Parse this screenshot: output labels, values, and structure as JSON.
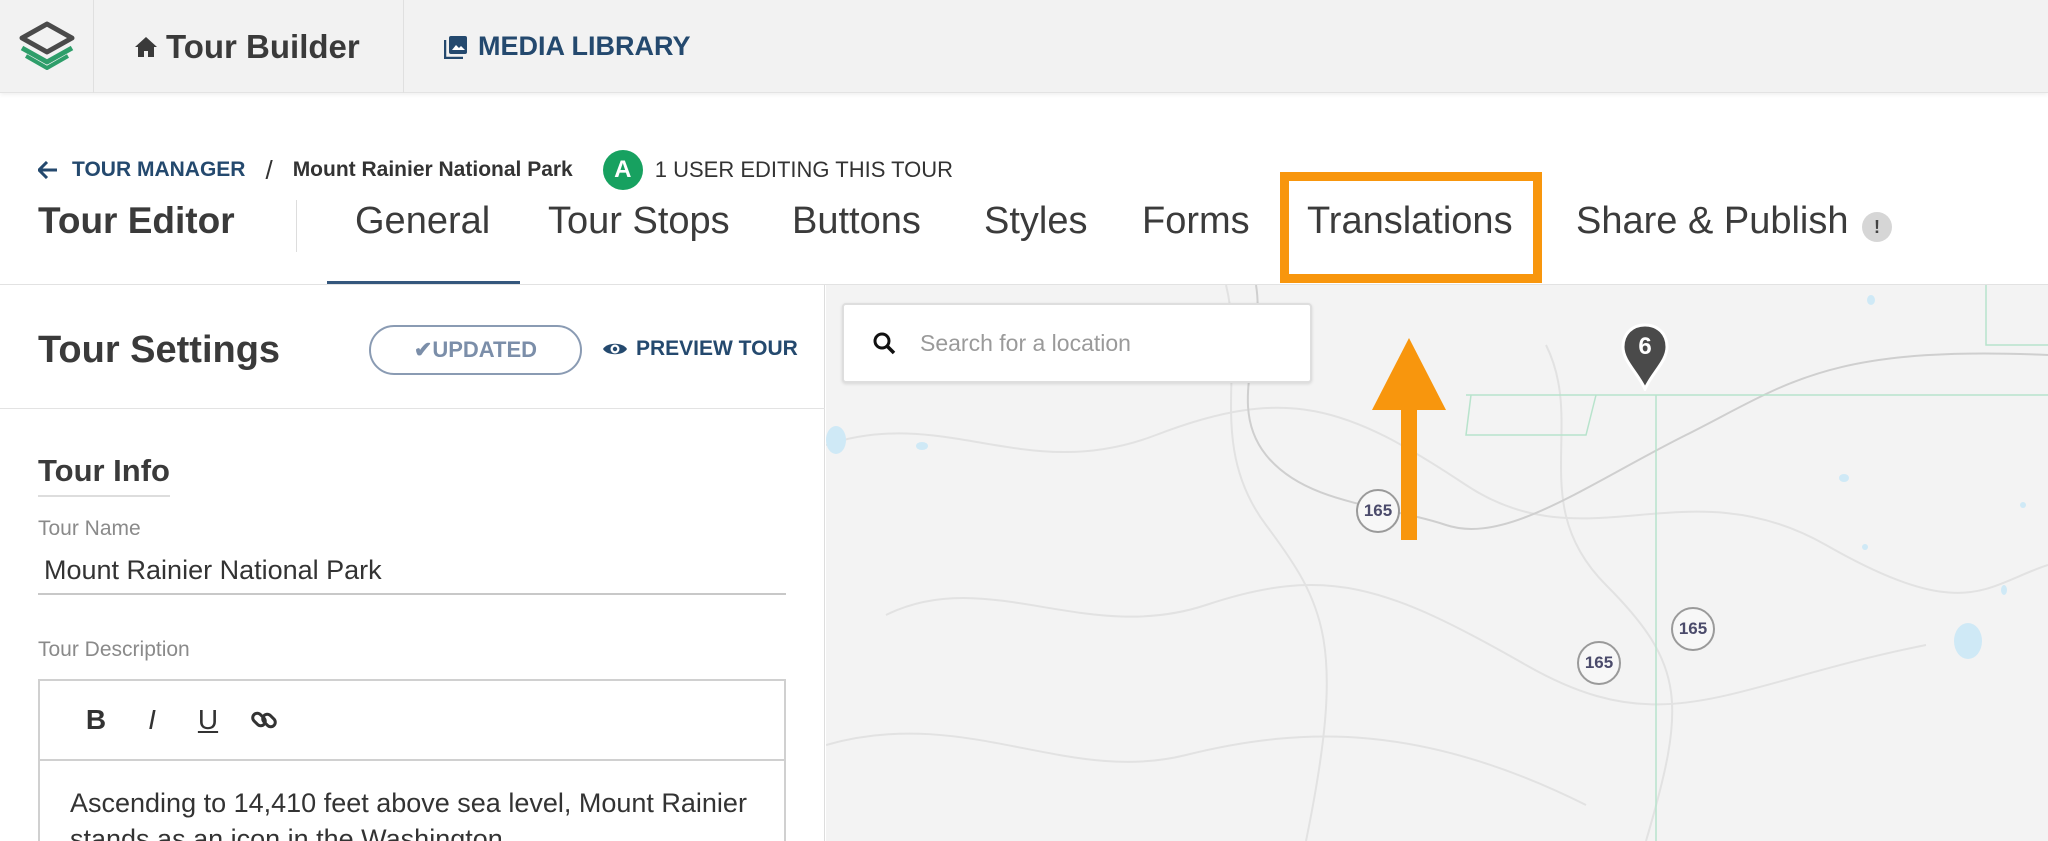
{
  "topbar": {
    "app_name": "Tour Builder",
    "media_library": "MEDIA LIBRARY"
  },
  "breadcrumb": {
    "back_label": "TOUR MANAGER",
    "separator": "/",
    "current": "Mount Rainier National Park",
    "avatar_initial": "A",
    "editing_status": "1 USER EDITING THIS TOUR"
  },
  "editor": {
    "title": "Tour Editor",
    "tabs": [
      {
        "label": "General",
        "active": true
      },
      {
        "label": "Tour Stops"
      },
      {
        "label": "Buttons"
      },
      {
        "label": "Styles"
      },
      {
        "label": "Forms"
      },
      {
        "label": "Translations",
        "highlighted": true
      },
      {
        "label": "Share & Publish"
      }
    ],
    "alert_badge": "!"
  },
  "settings": {
    "title": "Tour Settings",
    "updated_label": "✔UPDATED",
    "preview_label": "PREVIEW TOUR",
    "section_title": "Tour Info",
    "name_label": "Tour Name",
    "name_value": "Mount Rainier National Park",
    "description_label": "Tour Description",
    "toolbar": {
      "bold": "B",
      "italic": "I",
      "underline": "U"
    },
    "description_text": "Ascending to 14,410 feet above sea level, Mount Rainier stands as an icon in the Washington"
  },
  "map": {
    "search_placeholder": "Search for a location",
    "route_shields": [
      "165",
      "165",
      "165"
    ],
    "pin_label": "6"
  },
  "colors": {
    "accent_navy": "#24496e",
    "highlight_orange": "#f8960d",
    "avatar_green": "#17a160"
  }
}
